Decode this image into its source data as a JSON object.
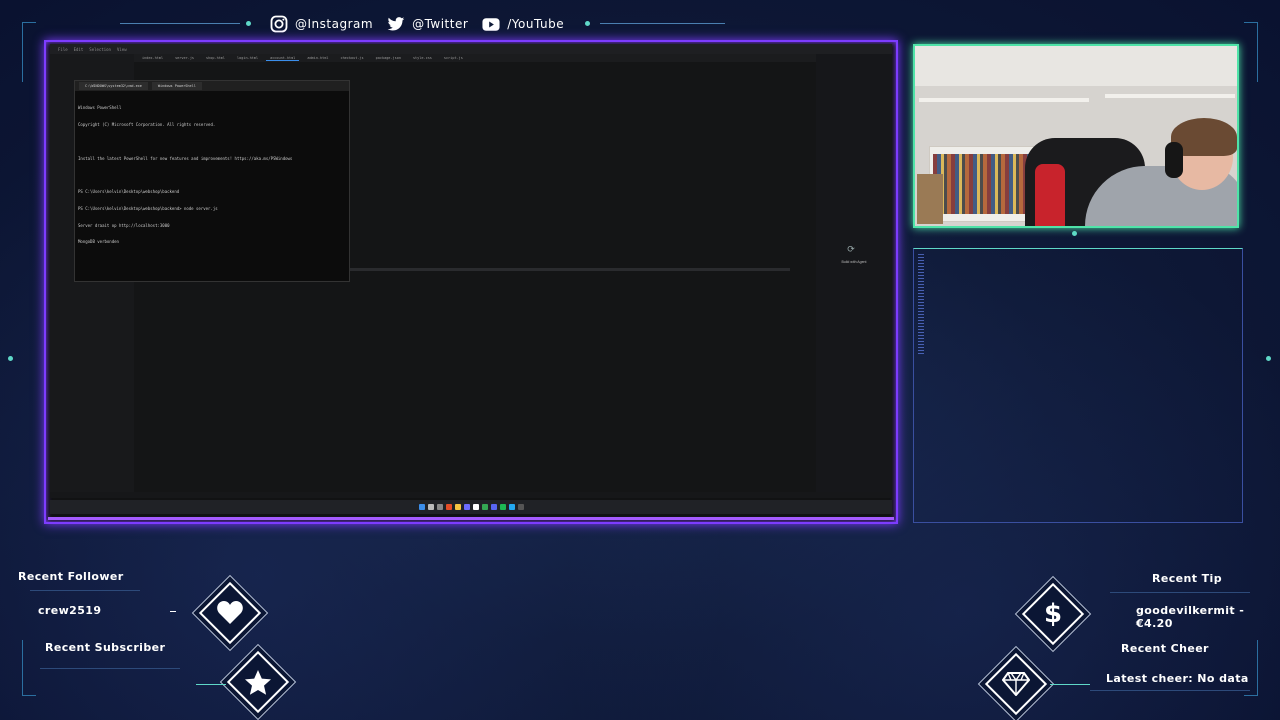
{
  "social": {
    "instagram": "@Instagram",
    "twitter": "@Twitter",
    "youtube": "/YouTube"
  },
  "icons": {
    "instagram": "instagram-icon",
    "twitter": "twitter-bird-icon",
    "youtube": "youtube-play-icon",
    "heart": "heart-icon",
    "star": "star-icon",
    "dollar": "dollar-icon",
    "gem": "diamond-gem-icon"
  },
  "screen": {
    "terminal": {
      "tabs": [
        "C:\\WINDOWS\\system32\\cmd.exe",
        "Windows PowerShell"
      ],
      "lines": [
        "Windows PowerShell",
        "Copyright (C) Microsoft Corporation. All rights reserved.",
        "",
        "Install the latest PowerShell for new features and improvements! https://aka.ms/PSWindows",
        "",
        "PS C:\\Users\\kelvin\\Desktop\\webshop\\backend",
        "PS C:\\Users\\kelvin\\Desktop\\webshop\\backend> node server.js",
        "Server draait op http://localhost:3000",
        "MongoDB verbonden"
      ]
    },
    "editor_tabs": [
      "index.html",
      "server.js",
      "shop.html",
      "login.html",
      "account.html",
      "admin.html",
      "checkout.js",
      "package.json",
      "style.css",
      "script.js"
    ],
    "chat_label": "Build with Agent"
  },
  "alerts": {
    "recent_follower_label": "Recent Follower",
    "recent_follower_value": "crew2519",
    "recent_subscriber_label": "Recent Subscriber",
    "recent_tip_label": "Recent Tip",
    "recent_tip_value": "goodevilkermit - €4.20",
    "recent_cheer_label": "Recent Cheer",
    "recent_cheer_value": "Latest cheer: No data"
  },
  "colors": {
    "accent_purple": "#7d3cff",
    "accent_green": "#4fe3a8",
    "deco_teal": "#5fd8c8",
    "background": "#0f1a38"
  }
}
